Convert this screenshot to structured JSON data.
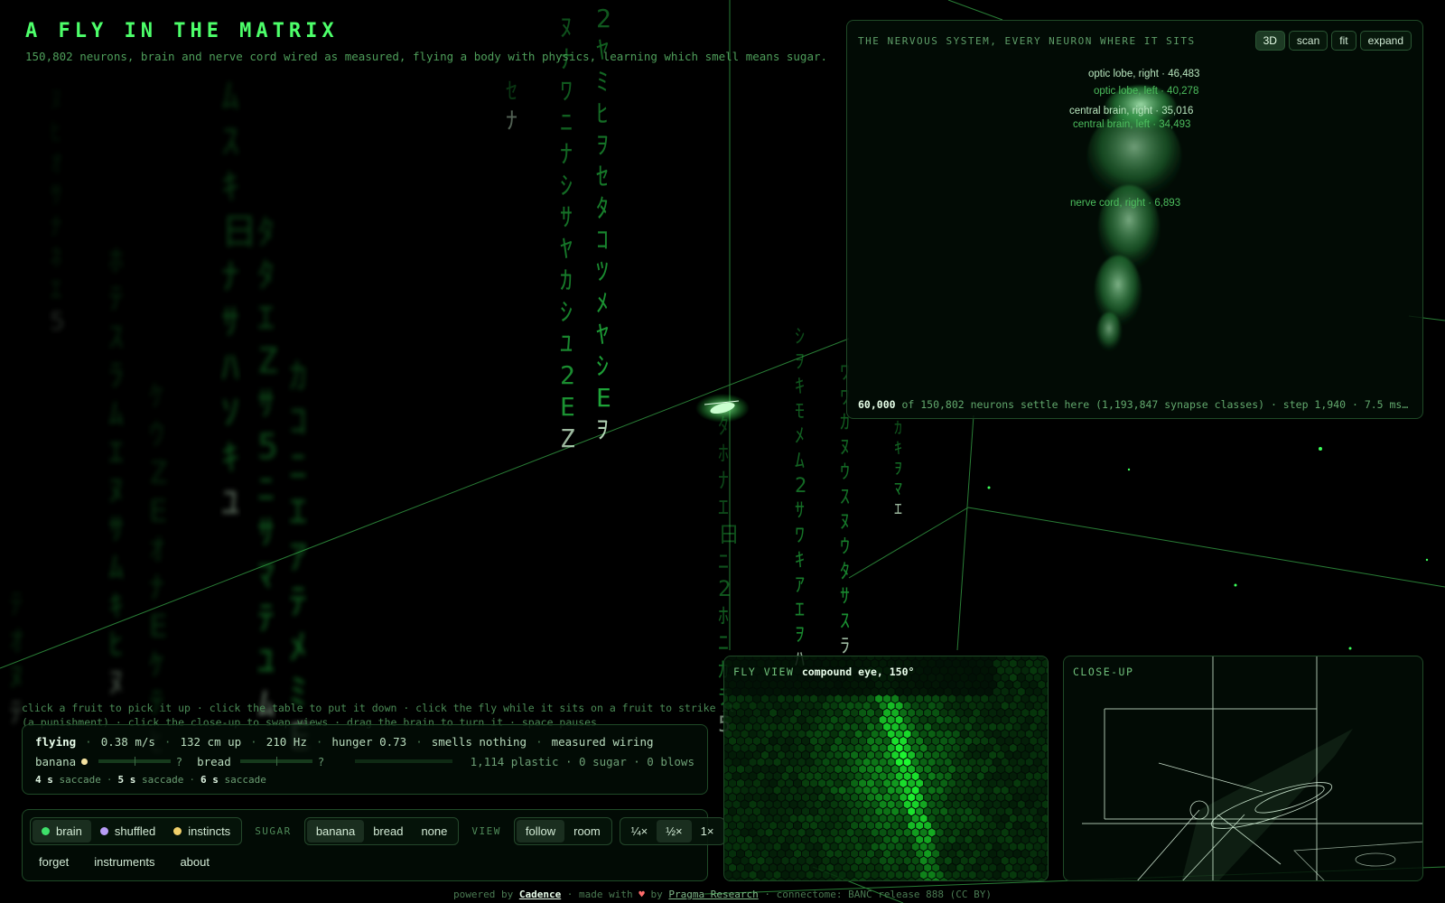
{
  "header": {
    "title": "A FLY IN THE MATRIX",
    "subtitle": "150,802 neurons, brain and nerve cord wired as measured, flying a body with physics, learning which smell means sugar."
  },
  "brain_panel": {
    "label": "THE NERVOUS SYSTEM, EVERY NEURON WHERE IT SITS",
    "buttons": [
      "3D",
      "scan",
      "fit",
      "expand"
    ],
    "active_button": "3D",
    "regions": [
      {
        "label": "optic lobe, right · 46,483"
      },
      {
        "label": "optic lobe, left · 40,278"
      },
      {
        "label": "central brain, right · 35,016"
      },
      {
        "label": "central brain, left · 34,493"
      },
      {
        "label": "nerve cord, right · 6,893"
      }
    ],
    "footer_bold": "60,000",
    "footer_text": " of 150,802 neurons settle here (1,193,847 synapse classes) · step 1,940 · 7.5 ms per …"
  },
  "hints": {
    "line1": "click a fruit to pick it up · click the table to put it down · click the fly while it sits on a fruit to strike it",
    "line2": "(a punishment) · click the close-up to swap views · drag the brain to turn it · space pauses"
  },
  "status": {
    "state": "flying",
    "speed": "0.38 m/s",
    "height": "132 cm up",
    "wingbeat": "210 Hz",
    "hunger": "hunger 0.73",
    "smell": "smells nothing",
    "wiring": "measured wiring",
    "odors": [
      {
        "name": "banana",
        "color": "#f3e1a0",
        "value": "?"
      },
      {
        "name": "bread",
        "color": "",
        "value": "?"
      }
    ],
    "counts": "1,114 plastic · 0 sugar · 0 blows",
    "saccades": [
      {
        "t": "4 s",
        "label": "saccade"
      },
      {
        "t": "5 s",
        "label": "saccade"
      },
      {
        "t": "6 s",
        "label": "saccade"
      }
    ]
  },
  "controls": {
    "brain_modes": [
      {
        "label": "brain",
        "color": "#3ee06a"
      },
      {
        "label": "shuffled",
        "color": "#b79cf5"
      },
      {
        "label": "instincts",
        "color": "#f0cf6a"
      }
    ],
    "brain_selected": "brain",
    "sugar_label": "SUGAR",
    "sugar_options": [
      "banana",
      "bread",
      "none"
    ],
    "sugar_selected": "banana",
    "view_label": "VIEW",
    "view_options": [
      "follow",
      "room"
    ],
    "view_selected": "follow",
    "speed_options": [
      "¼×",
      "½×",
      "1×"
    ],
    "speed_selected": "½×",
    "links": [
      "forget",
      "instruments",
      "about"
    ]
  },
  "fly_view": {
    "label": "FLY VIEW",
    "detail": "compound eye, 150°"
  },
  "close_up": {
    "label": "CLOSE-UP"
  },
  "footer": {
    "powered_prefix": "powered by ",
    "powered_name": "Cadence",
    "made_prefix": " · made with ",
    "heart": "♥",
    "by": " by ",
    "org": "Pragma Research",
    "connectome": " · connectome: BANC release 888 (CC BY)"
  },
  "colors": {
    "accent": "#4dff6a",
    "panel_border": "#1f4a27"
  },
  "rain_glyphs": [
    "ｦ",
    "ｱ",
    "ｳ",
    "ｴ",
    "ｵ",
    "ｶ",
    "ｷ",
    "ｹ",
    "ｺ",
    "ｻ",
    "ｼ",
    "ｽ",
    "ｾ",
    "ｿ",
    "ﾀ",
    "ﾂ",
    "ﾃ",
    "ﾅ",
    "ﾆ",
    "ﾇ",
    "ﾈ",
    "ﾊ",
    "ﾋ",
    "ﾎ",
    "ﾏ",
    "ﾐ",
    "ﾑ",
    "ﾒ",
    "ﾓ",
    "ﾔ",
    "ﾕ",
    "ﾗ",
    "ﾘ",
    "ﾜ",
    "2",
    "5",
    "7",
    "Z",
    "E",
    "日"
  ]
}
